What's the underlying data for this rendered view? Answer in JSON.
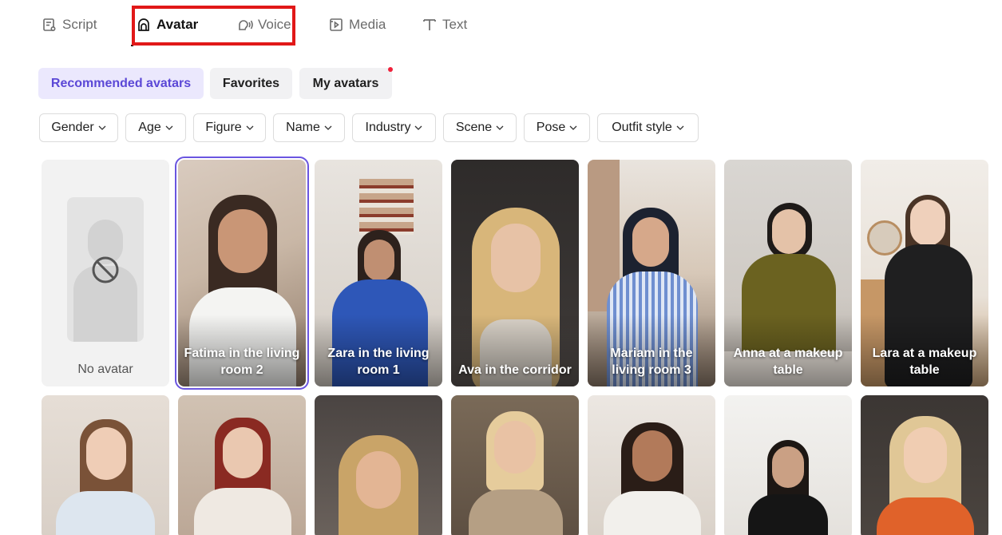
{
  "tabs": [
    {
      "label": "Script",
      "icon": "script-icon"
    },
    {
      "label": "Avatar",
      "icon": "avatar-icon",
      "active": true
    },
    {
      "label": "Voice",
      "icon": "voice-icon"
    },
    {
      "label": "Media",
      "icon": "media-icon"
    },
    {
      "label": "Text",
      "icon": "text-icon"
    }
  ],
  "categories": [
    {
      "label": "Recommended avatars",
      "active": true
    },
    {
      "label": "Favorites"
    },
    {
      "label": "My avatars",
      "has_notification_dot": true
    }
  ],
  "filters": [
    "Gender",
    "Age",
    "Figure",
    "Name",
    "Industry",
    "Scene",
    "Pose",
    "Outfit style"
  ],
  "row1": [
    {
      "label": "No avatar",
      "icon": "no-avatar-icon"
    },
    {
      "label": "Fatima in the living room 2",
      "selected": true
    },
    {
      "label": "Zara in the living room 1"
    },
    {
      "label": "Ava in the corridor"
    },
    {
      "label": "Mariam in the living room 3"
    },
    {
      "label": "Anna at a makeup table"
    },
    {
      "label": "Lara at a makeup table"
    }
  ],
  "row2_count": 7,
  "colors": {
    "accent": "#5b48d6",
    "accent_bg": "#ebe8fd",
    "selected_border": "#6a55e0",
    "highlight_box": "#e11818",
    "notification_dot": "#f0203a"
  }
}
